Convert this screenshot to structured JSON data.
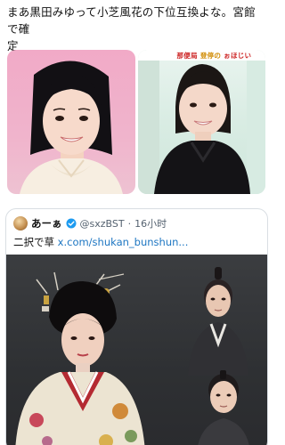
{
  "post": {
    "text_line1": "まあ黒田みゆって小芝風花の下位互換よな。宮館で確",
    "text_line2": "定"
  },
  "media": {
    "right_banner_red": "那便局",
    "right_banner_yellow": "登停の",
    "right_banner_tail": "ぉほじい"
  },
  "quoted_tweet": {
    "display_name": "あーぁ",
    "handle": "@sxzBST",
    "separator": "·",
    "time": "16小时",
    "text_prefix": "二択で草 ",
    "link": "x.com/shukan_bunshun..."
  },
  "colors": {
    "link": "#1d76c2",
    "verified": "#1d9bf0",
    "text": "#111111",
    "muted": "#556270"
  }
}
